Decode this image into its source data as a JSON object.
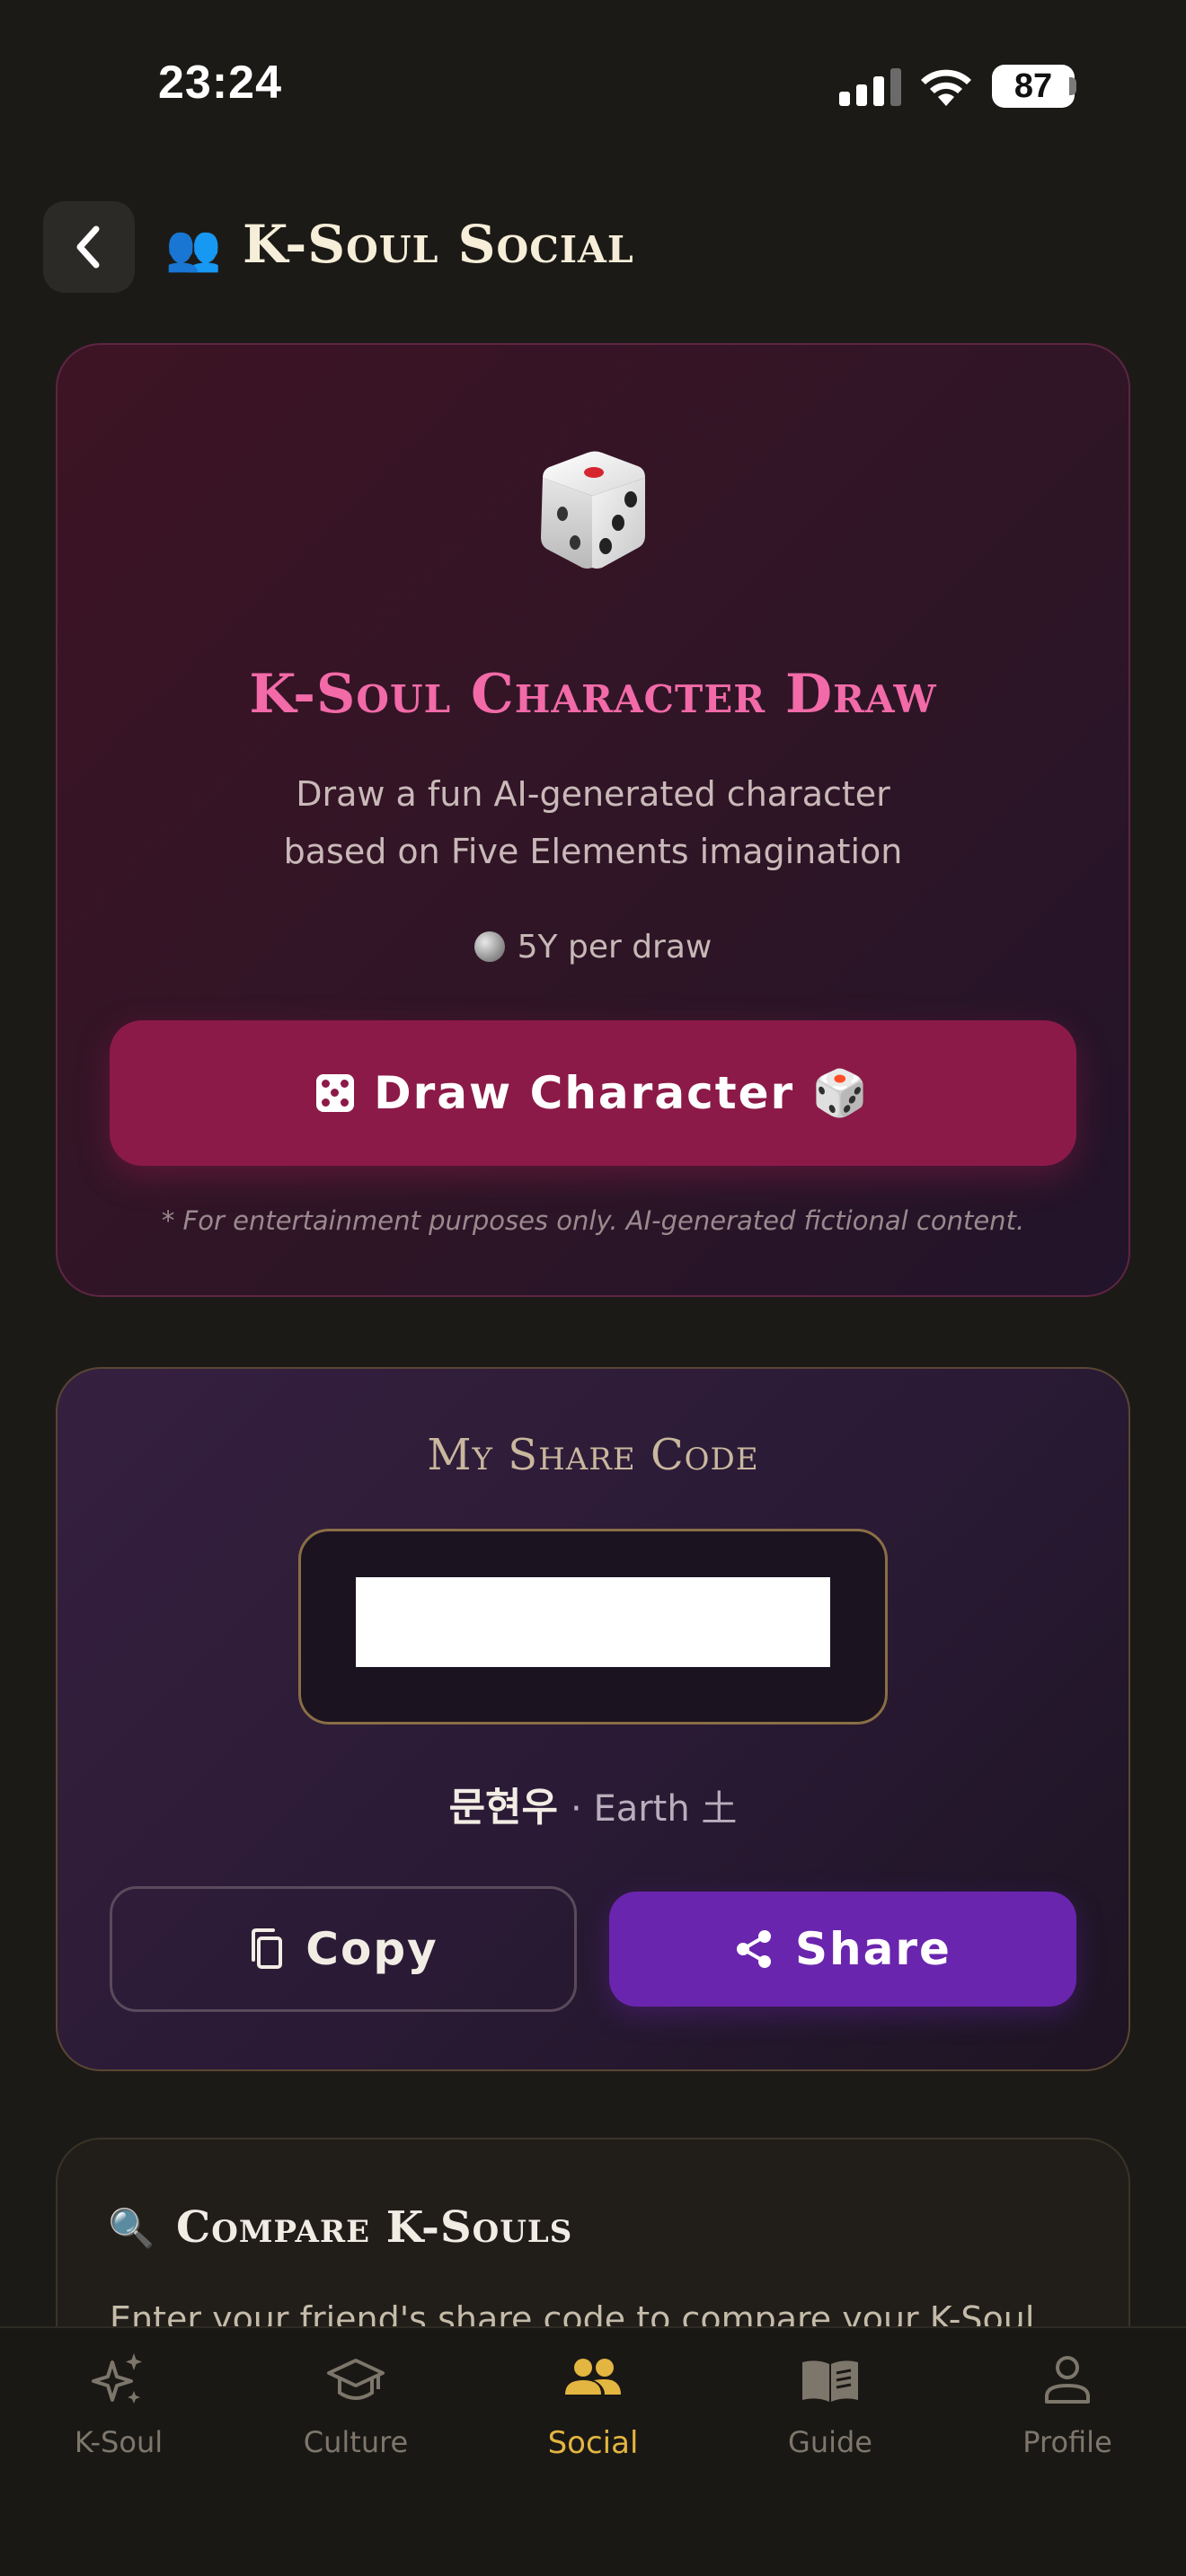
{
  "status_bar": {
    "time": "23:24",
    "battery": "87"
  },
  "header": {
    "icon": "👥",
    "title": "K-Soul Social",
    "back_icon": "chevron-left-icon"
  },
  "draw_card": {
    "icon": "dice-icon",
    "title": "K-Soul Character Draw",
    "description_line1": "Draw a fun AI-generated character",
    "description_line2": "based on Five Elements imagination",
    "cost": "5Y per draw",
    "button_label": "Draw Character 🎲",
    "disclaimer": "* For entertainment purposes only. AI-generated fictional content."
  },
  "share_card": {
    "title": "My Share Code",
    "share_code": "",
    "name": "문현우",
    "element": "· Earth 土",
    "copy_label": "Copy",
    "share_label": "Share"
  },
  "compare_card": {
    "icon": "🔍",
    "title": "Compare K-Souls",
    "description": "Enter your friend's share code to compare your K-Soul"
  },
  "tabs": [
    {
      "label": "K-Soul",
      "icon": "sparkles-icon",
      "active": false
    },
    {
      "label": "Culture",
      "icon": "graduation-cap-icon",
      "active": false
    },
    {
      "label": "Social",
      "icon": "people-icon",
      "active": true
    },
    {
      "label": "Guide",
      "icon": "book-icon",
      "active": false
    },
    {
      "label": "Profile",
      "icon": "person-icon",
      "active": false
    }
  ],
  "colors": {
    "accent_pink": "#f26aa8",
    "draw_button": "#8c1a48",
    "share_button": "#6a25ae",
    "tab_active": "#e3b541"
  }
}
